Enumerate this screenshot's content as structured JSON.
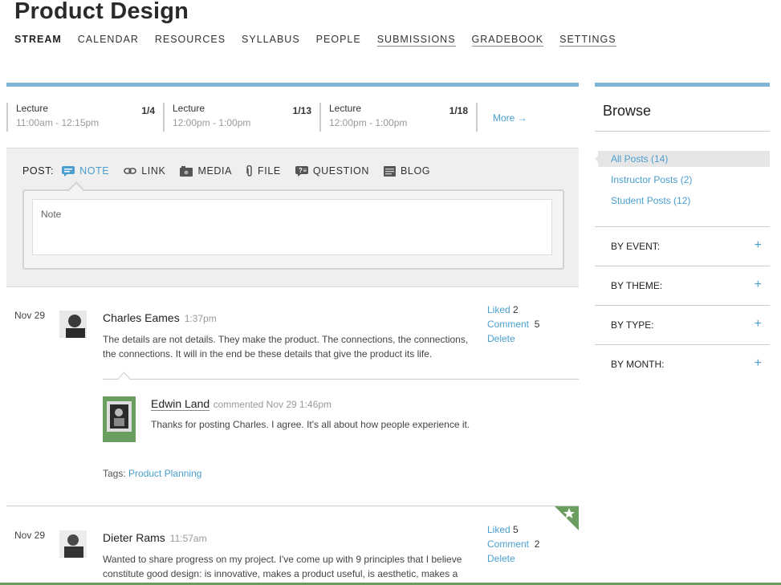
{
  "course": {
    "title": "Product Design"
  },
  "nav": [
    {
      "label": "STREAM"
    },
    {
      "label": "CALENDAR"
    },
    {
      "label": "RESOURCES"
    },
    {
      "label": "SYLLABUS"
    },
    {
      "label": "PEOPLE"
    },
    {
      "label": "SUBMISSIONS"
    },
    {
      "label": "GRADEBOOK"
    },
    {
      "label": "SETTINGS"
    }
  ],
  "lectures": [
    {
      "name": "Lecture",
      "date": "1/4",
      "time": "11:00am - 12:15pm"
    },
    {
      "name": "Lecture",
      "date": "1/13",
      "time": "12:00pm - 1:00pm"
    },
    {
      "name": "Lecture",
      "date": "1/18",
      "time": "12:00pm - 1:00pm"
    }
  ],
  "more_label": "More →",
  "composer": {
    "post_label": "POST:",
    "types": [
      {
        "label": "NOTE",
        "icon": "note-icon"
      },
      {
        "label": "LINK",
        "icon": "link-icon"
      },
      {
        "label": "MEDIA",
        "icon": "media-icon"
      },
      {
        "label": "FILE",
        "icon": "paperclip-icon"
      },
      {
        "label": "QUESTION",
        "icon": "question-icon"
      },
      {
        "label": "BLOG",
        "icon": "blog-icon"
      }
    ],
    "placeholder": "Note"
  },
  "posts": [
    {
      "date": "Nov 29",
      "author": "Charles Eames",
      "time": "1:37pm",
      "body": "The details are not details. They make the product. The connections, the connections, the connections. It will in the end be these details that give the product its life.",
      "liked_label": "Liked",
      "liked": "2",
      "comment_label": "Comment",
      "comments": "5",
      "delete_label": "Delete",
      "comment": {
        "author": "Edwin Land",
        "meta": "commented Nov 29 1:46pm",
        "body": "Thanks for posting Charles. I agree. It's all about how people experience it."
      },
      "tags_label": "Tags:",
      "tag": "Product Planning"
    },
    {
      "date": "Nov 29",
      "author": "Dieter Rams",
      "time": "11:57am",
      "body": "Wanted to share progress on my project. I've come up with 9 principles that I believe constitute good design: is innovative, makes a product useful, is aesthetic, makes a",
      "liked_label": "Liked",
      "liked": "5",
      "comment_label": "Comment",
      "comments": "2",
      "delete_label": "Delete"
    }
  ],
  "sidebar": {
    "title": "Browse",
    "links": [
      {
        "label": "All Posts (14)"
      },
      {
        "label": "Instructor Posts (2)"
      },
      {
        "label": "Student Posts (12)"
      }
    ],
    "filters": [
      {
        "label": "BY EVENT:"
      },
      {
        "label": "BY THEME:"
      },
      {
        "label": "BY TYPE:"
      },
      {
        "label": "BY MONTH:"
      }
    ],
    "plus": "+"
  },
  "colors": {
    "accent": "#7fb5d5",
    "link": "#4a9fcf",
    "green": "#6a9e5e"
  }
}
